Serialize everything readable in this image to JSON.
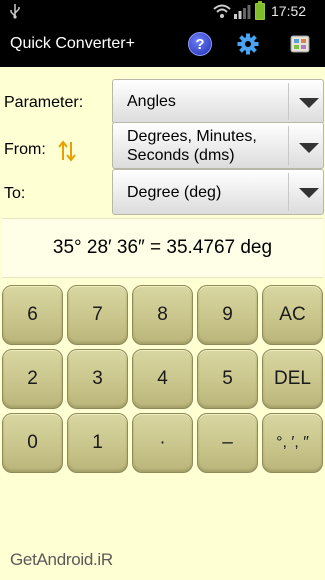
{
  "status_bar": {
    "time": "17:52",
    "icons": [
      "usb-icon",
      "wifi-icon",
      "signal-icon",
      "battery-icon"
    ]
  },
  "action_bar": {
    "title": "Quick Converter+",
    "help_label": "?",
    "icons": [
      "help-icon",
      "settings-gear-icon",
      "app-menu-icon"
    ]
  },
  "form": {
    "parameter": {
      "label": "Parameter:",
      "value": "Angles"
    },
    "from": {
      "label": "From:",
      "value": "Degrees, Minutes,\nSeconds (dms)",
      "swap_icon": "swap-arrows-icon"
    },
    "to": {
      "label": "To:",
      "value": "Degree (deg)"
    }
  },
  "result": {
    "text": "35° 28′ 36″ = 35.4767 deg"
  },
  "keypad": {
    "rows": [
      [
        "6",
        "7",
        "8",
        "9",
        "AC"
      ],
      [
        "2",
        "3",
        "4",
        "5",
        "DEL"
      ],
      [
        "0",
        "1",
        "·",
        "–",
        "°, ′, ″"
      ]
    ]
  },
  "watermark": "GetAndroid.iR",
  "colors": {
    "background": "#FFFFD4",
    "key_face": "#C8C48A",
    "action_bar": "#000000"
  }
}
